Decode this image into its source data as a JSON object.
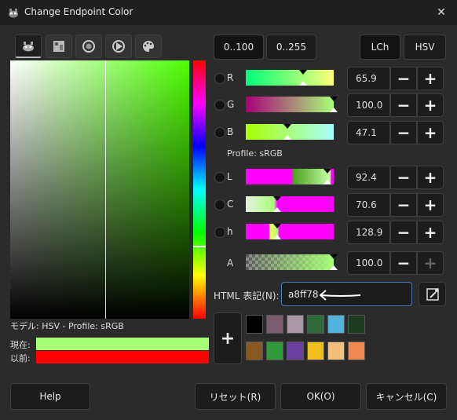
{
  "window": {
    "title": "Change Endpoint Color",
    "close": "✕"
  },
  "range_buttons": {
    "r100": "0..100",
    "r255": "0..255"
  },
  "model_buttons": {
    "lch": "LCh",
    "hsv": "HSV"
  },
  "channels": [
    {
      "label": "R",
      "value": "65.9"
    },
    {
      "label": "G",
      "value": "100.0"
    },
    {
      "label": "B",
      "value": "47.1"
    },
    {
      "label": "L",
      "value": "92.4"
    },
    {
      "label": "C",
      "value": "70.6"
    },
    {
      "label": "h",
      "value": "128.9"
    },
    {
      "label": "A",
      "value": "100.0"
    }
  ],
  "profile_label": "Profile: sRGB",
  "html_notation": {
    "label": "HTML 表記(N):",
    "value": "a8ff78"
  },
  "model_info": "モデル: HSV - Profile: sRGB",
  "current_label": "現在:",
  "previous_label": "以前:",
  "colors": {
    "current": "#a8ff78",
    "previous": "#ff0000"
  },
  "history": [
    "#000000",
    "#7a5c6e",
    "#a899a5",
    "#2f6b3a",
    "#4fb3de",
    "#1d3b22",
    "#8a5a24",
    "#2e9a3a",
    "#6a3f9e",
    "#f2c01e",
    "#f2c07a",
    "#ee8a4f"
  ],
  "plus": "+",
  "minus": "−",
  "buttons": {
    "help": "Help",
    "reset": "リセット(R)",
    "ok": "OK(O)",
    "cancel": "キャンセル(C)"
  }
}
